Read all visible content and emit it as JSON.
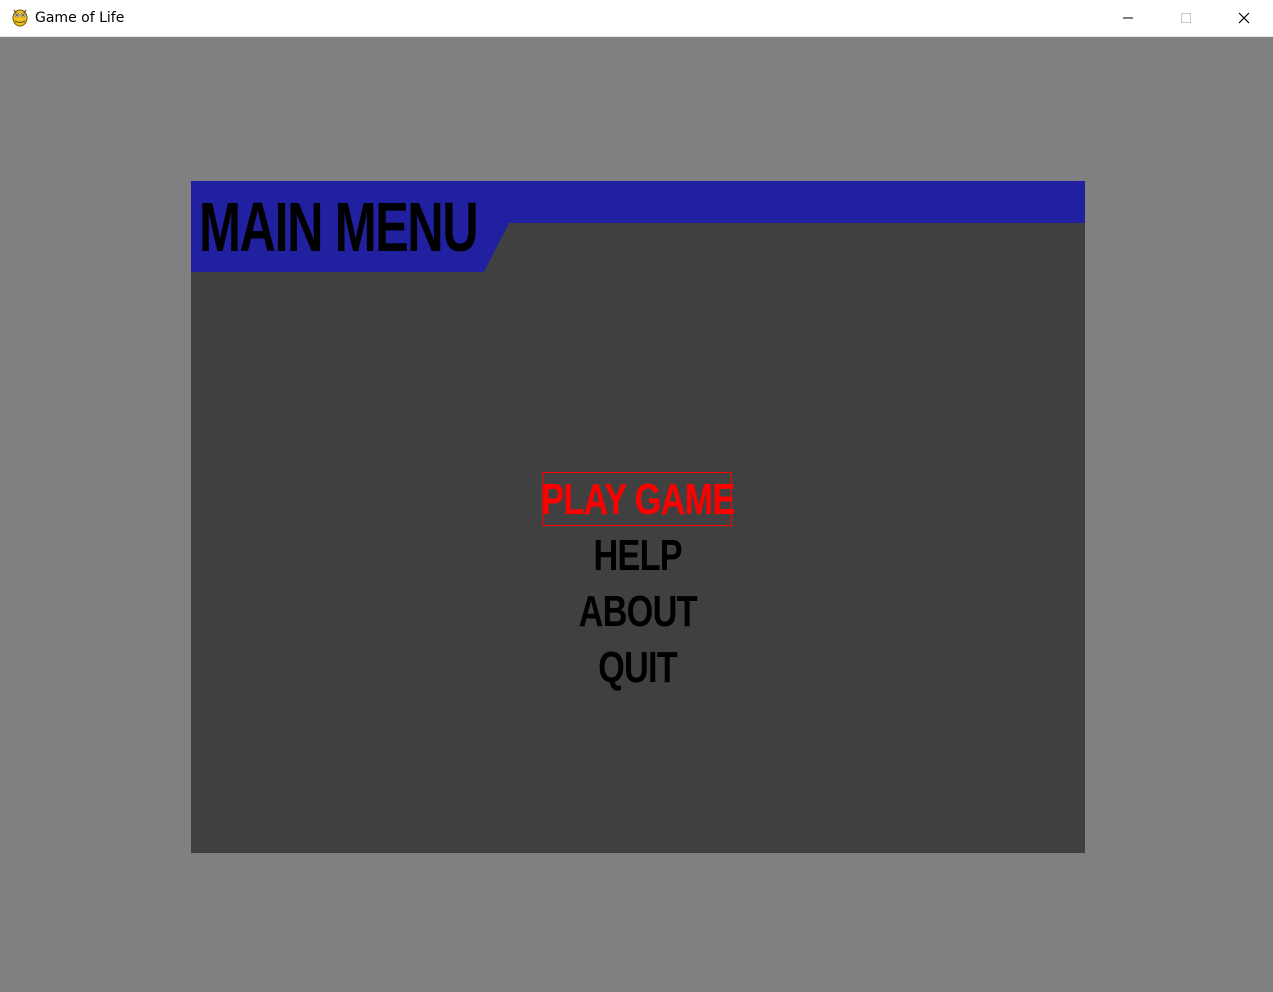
{
  "window": {
    "title": "Game of Life",
    "icon": "pygame-snake-icon",
    "controls": {
      "minimize": "minimize-icon",
      "maximize": "maximize-icon",
      "close": "close-icon"
    }
  },
  "colors": {
    "background": "#808080",
    "panel": "#404040",
    "header": "#2020a0",
    "text": "#000000",
    "selected": "#ff0000"
  },
  "menu": {
    "title": "MAIN MENU",
    "items": [
      {
        "label": "PLAY GAME",
        "selected": true
      },
      {
        "label": "HELP",
        "selected": false
      },
      {
        "label": "ABOUT",
        "selected": false
      },
      {
        "label": "QUIT",
        "selected": false
      }
    ]
  }
}
